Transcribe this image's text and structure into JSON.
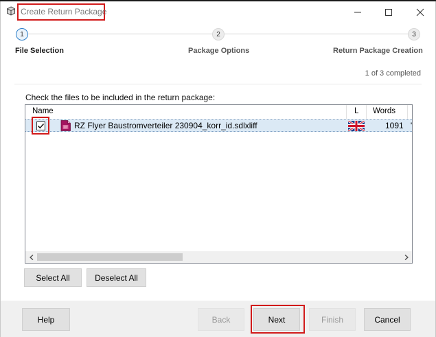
{
  "window": {
    "title": "Create Return Package",
    "icon": "package-icon",
    "controls": [
      "minimize-icon",
      "maximize-icon",
      "close-icon"
    ]
  },
  "steps": [
    {
      "number": "1",
      "label": "File Selection",
      "active": true
    },
    {
      "number": "2",
      "label": "Package Options",
      "active": false
    },
    {
      "number": "3",
      "label": "Return Package Creation",
      "active": false
    }
  ],
  "progress": "1 of 3 completed",
  "instruction": "Check the files to be included in the return package:",
  "filelist": {
    "columns": {
      "name": "Name",
      "language": "L",
      "words": "Words"
    },
    "rows": [
      {
        "checked": true,
        "icon": "sdlxliff-file-icon",
        "name": "RZ Flyer Baustromverteiler 230904_korr_id.sdlxliff",
        "language_flag": "uk-flag-icon",
        "words": "1091"
      }
    ]
  },
  "select_buttons": {
    "select_all": "Select All",
    "deselect_all": "Deselect All"
  },
  "footer": {
    "help": "Help",
    "back": "Back",
    "next": "Next",
    "finish": "Finish",
    "cancel": "Cancel"
  },
  "colors": {
    "highlight_box": "#d11a1a",
    "active_step": "#2d7fc9",
    "selected_row": "#dbe9f5",
    "file_icon": "#a3145f"
  }
}
